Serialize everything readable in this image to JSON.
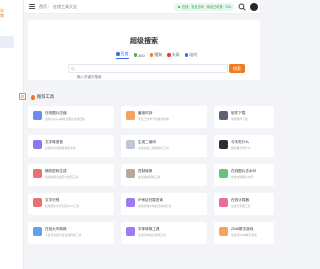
{
  "sidebar": {
    "logo_text": "站\n集",
    "badge": "收"
  },
  "header": {
    "breadcrumb_home": "首页",
    "breadcrumb_sep": "/",
    "breadcrumb_current": "在线工具大全",
    "status_text": "在线 · 安全访问 · 网站已收录 · SSL",
    "status_color": "#2ea15a"
  },
  "hero": {
    "title": "超级搜索",
    "tabs": [
      {
        "label": "百度",
        "color": "#3a6ee8",
        "active": true
      },
      {
        "label": "360",
        "color": "#4caf50",
        "active": false
      },
      {
        "label": "搜狗",
        "color": "#f07a22",
        "active": false
      },
      {
        "label": "头条",
        "color": "#e53935",
        "active": false
      },
      {
        "label": "站内",
        "color": "#3a6ee8",
        "active": false
      }
    ],
    "search_placeholder": "输入关键字搜索",
    "search_button": "搜索",
    "accent": "#f07a22"
  },
  "section": {
    "title": "推荐工具"
  },
  "tools": [
    {
      "name": "在线图片压缩",
      "desc": "支持jpg/png等格式图片在线压缩",
      "icon": "image-icon",
      "color": "#6c8cf5"
    },
    {
      "name": "番茄时钟",
      "desc": "专注工作学习的番茄时钟",
      "icon": "clock-icon",
      "color": "#f5a45d"
    },
    {
      "name": "软件下载",
      "desc": "常用软件下载",
      "icon": "download-icon",
      "color": "#5b6472"
    },
    {
      "name": "文字转语音",
      "desc": "在线文字转换成语音文件",
      "icon": "voice-icon",
      "color": "#8a78f0"
    },
    {
      "name": "生成二维码",
      "desc": "在线生成二维码图片工具",
      "icon": "qrcode-icon",
      "color": "#bfc6d4"
    },
    {
      "name": "今天吃什么",
      "desc": "随机推荐吃什么",
      "icon": "food-icon",
      "color": "#2b2f38"
    },
    {
      "name": "随机密码生成",
      "desc": "在线随机生成安全密码工具",
      "icon": "lock-icon",
      "color": "#e97272"
    },
    {
      "name": "进制转换",
      "desc": "在线进制转换工具",
      "icon": "convert-icon",
      "color": "#b5a99a"
    },
    {
      "name": "在线图片去水印",
      "desc": "在线去除图片水印",
      "icon": "erase-icon",
      "color": "#6cc07a"
    },
    {
      "name": "文字识别",
      "desc": "在线图片文字识别OCR工具",
      "icon": "ocr-icon",
      "color": "#e57373"
    },
    {
      "name": "IP地址归属查询",
      "desc": "在线查询IP地址归属地信息",
      "icon": "ip-icon",
      "color": "#9c7cf0"
    },
    {
      "name": "在线计算器",
      "desc": "在线计算器工具",
      "icon": "calc-icon",
      "color": "#e96c9b"
    },
    {
      "name": "在线大写转换",
      "desc": "人民币金额大写在线转换工具",
      "icon": "money-icon",
      "color": "#5ba3f0"
    },
    {
      "name": "字体转换工具",
      "desc": "在线字体格式转换工具",
      "icon": "font-icon",
      "color": "#9c7cf0"
    },
    {
      "name": "2048数字游戏",
      "desc": "在线玩2048数字游戏",
      "icon": "game-icon",
      "color": "#f5a45d"
    }
  ]
}
